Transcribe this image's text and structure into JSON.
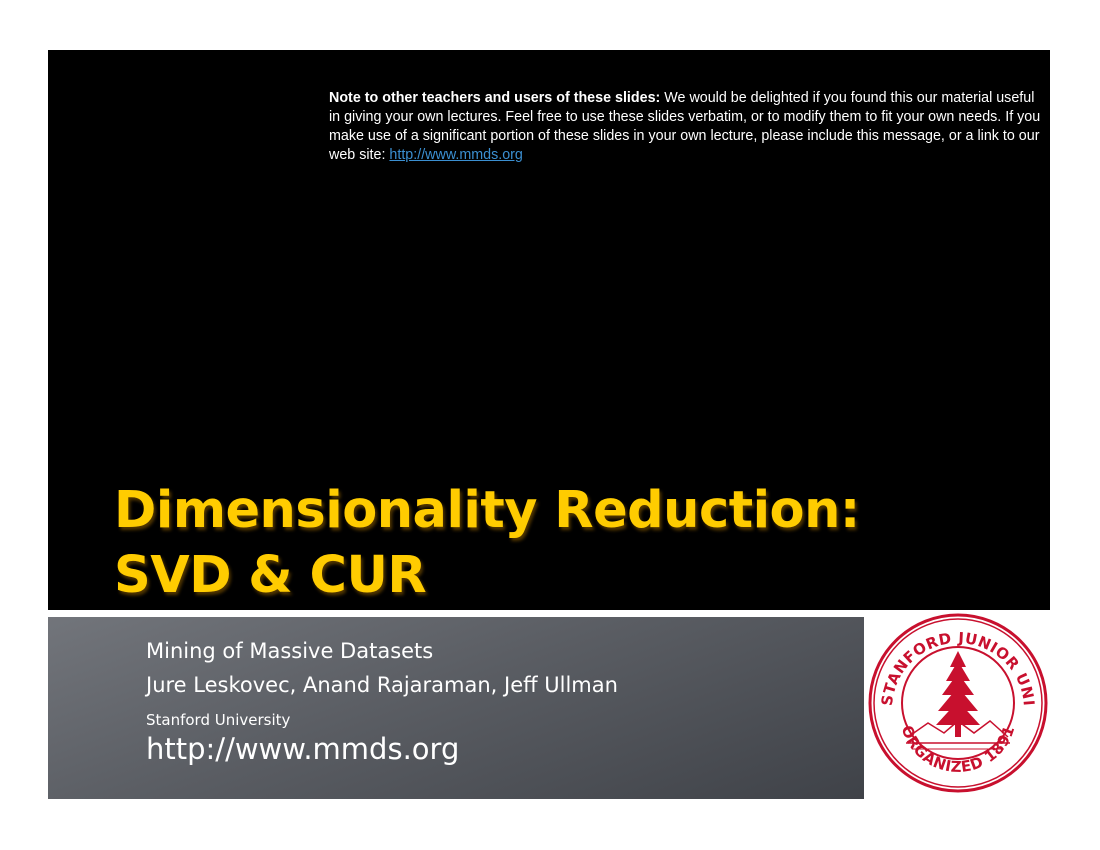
{
  "note": {
    "bold": "Note to other teachers and users of these slides:",
    "body": " We would be delighted if you found this our material useful in giving your own lectures. Feel free to use these slides verbatim, or to modify them to fit your own needs. If you make use of a significant portion of these slides in your own lecture, please include this message, or a link to our web site: ",
    "link": "http://www.mmds.org"
  },
  "title": {
    "line1": "Dimensionality Reduction:",
    "line2": "SVD & CUR"
  },
  "subtitle": {
    "course": "Mining of Massive Datasets",
    "authors": "Jure Leskovec, Anand Rajaraman, Jeff Ullman",
    "university": "Stanford University",
    "url": "http://www.mmds.org"
  },
  "seal": {
    "text_top": "LELAND STANFORD JUNIOR UNIVERSITY",
    "text_bottom": "ORGANIZED 1891",
    "color": "#c8102e"
  },
  "colors": {
    "title": "#ffcc00",
    "link": "#3b8fd1"
  }
}
